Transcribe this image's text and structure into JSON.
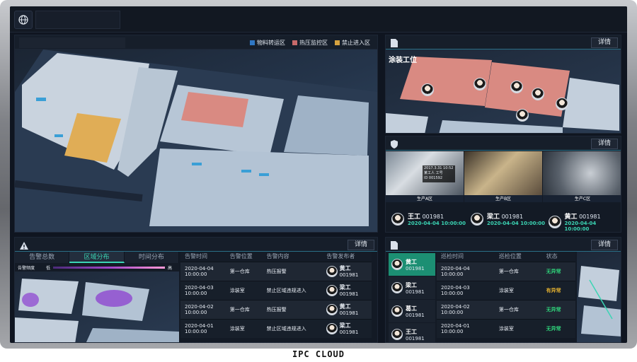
{
  "map": {
    "legend": [
      {
        "label": "物料转运区",
        "color": "#2f77c4"
      },
      {
        "label": "热压监控区",
        "color": "#c86a6a"
      },
      {
        "label": "禁止进入区",
        "color": "#d6a23f"
      }
    ]
  },
  "coating": {
    "title": "涂装工位",
    "detail": "详情"
  },
  "production": {
    "detail": "详情",
    "cameras": [
      {
        "label": "生产A区",
        "overlay_date": "2017.3.31 10:52",
        "overlay_name": "某工人 工号",
        "overlay_id": "ID 001592"
      },
      {
        "label": "生产B区"
      },
      {
        "label": "生产C区"
      }
    ],
    "workers": [
      {
        "name": "王工",
        "id": "001981",
        "date": "2020-04-04 10:00:00"
      },
      {
        "name": "梁工",
        "id": "001981",
        "date": "2020-04-04 10:00:00"
      },
      {
        "name": "黄工",
        "id": "001981",
        "date": "2020-04-04 10:00:00"
      }
    ]
  },
  "alarm": {
    "detail": "详情",
    "tabs": [
      "告警总数",
      "区域分布",
      "时间分布"
    ],
    "active_tab": 1,
    "scale_low": "告警频度",
    "scale_mid": "低",
    "scale_high": "高",
    "columns": [
      "告警时间",
      "告警位置",
      "告警内容",
      "告警发布者"
    ],
    "rows": [
      {
        "time1": "2020-04-04",
        "time2": "10:00:00",
        "location": "第一仓库",
        "content": "热压报警",
        "name": "黄工",
        "id": "001981"
      },
      {
        "time1": "2020-04-03",
        "time2": "10:00:00",
        "location": "涂装室",
        "content": "禁止区域违规进入",
        "name": "梁工",
        "id": "001981"
      },
      {
        "time1": "2020-04-02",
        "time2": "10:00:00",
        "location": "第一仓库",
        "content": "热压报警",
        "name": "黄工",
        "id": "001981"
      },
      {
        "time1": "2020-04-01",
        "time2": "10:00:00",
        "location": "涂装室",
        "content": "禁止区域违规进入",
        "name": "梁工",
        "id": "001981"
      }
    ]
  },
  "patrol": {
    "detail": "详情",
    "people": [
      {
        "name": "黄工",
        "id": "001981"
      },
      {
        "name": "梁工",
        "id": "001981"
      },
      {
        "name": "葛工",
        "id": "001981"
      },
      {
        "name": "王工",
        "id": "001981"
      }
    ],
    "columns": [
      "巡检时间",
      "巡检位置",
      "状态"
    ],
    "rows": [
      {
        "time1": "2020-04-04",
        "time2": "10:00:00",
        "location": "第一仓库",
        "status": "无异常",
        "status_color": "#2fd27a"
      },
      {
        "time1": "2020-04-03",
        "time2": "10:00:00",
        "location": "涂装室",
        "status": "有异常",
        "status_color": "#e3b02f"
      },
      {
        "time1": "2020-04-02",
        "time2": "10:00:00",
        "location": "第一仓库",
        "status": "无异常",
        "status_color": "#2fd27a"
      },
      {
        "time1": "2020-04-01",
        "time2": "10:00:00",
        "location": "涂装室",
        "status": "无异常",
        "status_color": "#2fd27a"
      }
    ]
  },
  "brand": "IPC CLOUD"
}
